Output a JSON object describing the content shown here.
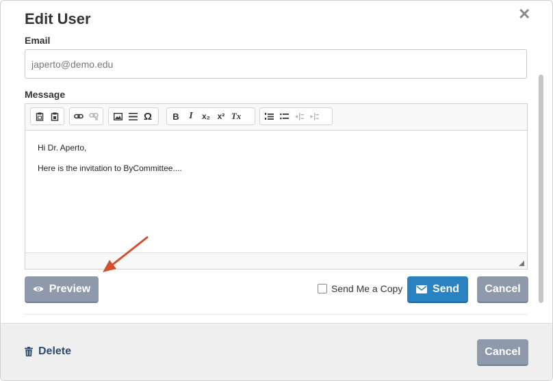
{
  "modal": {
    "title": "Edit User",
    "close_icon": "close-icon"
  },
  "form": {
    "email_label": "Email",
    "email_value": "japerto@demo.edu",
    "message_label": "Message",
    "message_lines": [
      "Hi Dr. Aperto,",
      "Here is the invitation to ByCommittee...."
    ]
  },
  "toolbar": {
    "items": [
      "paste-icon",
      "paste-word-icon",
      "link-icon",
      "unlink-icon",
      "image-icon",
      "horizontal-line-icon",
      "special-character-icon",
      "bold-icon",
      "italic-icon",
      "subscript-icon",
      "superscript-icon",
      "remove-format-icon",
      "numbered-list-icon",
      "bulleted-list-icon",
      "outdent-icon",
      "indent-icon"
    ],
    "omega": "Ω",
    "bold": "B",
    "italic": "I",
    "sub": "x₂",
    "sup": "x²",
    "clear": "Tx"
  },
  "actions": {
    "preview_label": "Preview",
    "send_copy_label": "Send Me a Copy",
    "send_copy_checked": false,
    "send_label": "Send",
    "cancel_label": "Cancel"
  },
  "footer": {
    "delete_label": "Delete",
    "cancel_label": "Cancel"
  },
  "colors": {
    "primary": "#2a82c2",
    "secondary": "#8e9aab",
    "link": "#2f4a6f",
    "annotation_arrow": "#d2502e"
  }
}
